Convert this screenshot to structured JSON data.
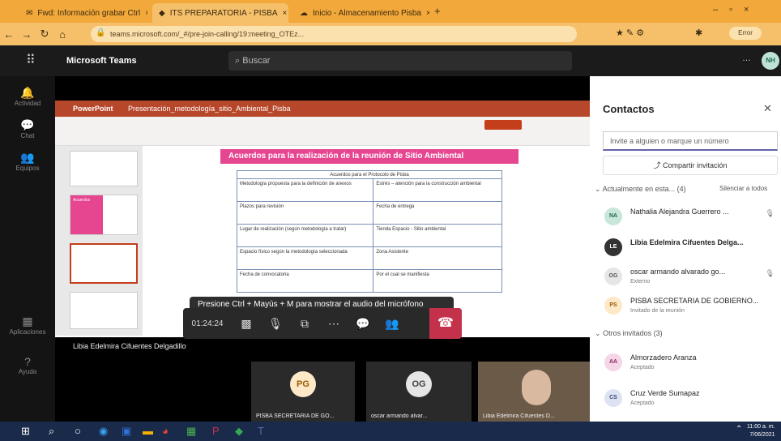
{
  "browser": {
    "tabs": [
      {
        "title": "Fwd: Información grabar Ctrl",
        "active": false
      },
      {
        "title": "ITS PREPARATORIA - PISBA",
        "active": true
      },
      {
        "title": "Inicio - Almacenamiento Pisba",
        "active": false
      }
    ],
    "url": "teams.microsoft.com/_#/pre-join-calling/19:meeting_OTEz..."
  },
  "teams": {
    "app_name": "Microsoft Teams",
    "search_placeholder": "Buscar",
    "user_initials": "NH"
  },
  "rail": {
    "items": [
      "Actividad",
      "Chat",
      "Equipos",
      "Aplicaciones",
      "Ayuda"
    ]
  },
  "ppt": {
    "app": "PowerPoint",
    "file": "Presentación_metodología_sitio_Ambiental_Pisba",
    "slide_title": "Acuerdos para la realización de la reunión de Sitio Ambiental",
    "table_header": "Acuerdos para el Protocolo de Pisba",
    "rows": [
      [
        "Metodología propuesta para la definición de anexos",
        "Estrés – atención para la construcción ambiental"
      ],
      [
        "Plazos para revisión",
        "Fecha de entrega"
      ],
      [
        "Lugar de realización (según metodología a tratar)",
        "Tienda Espacio - Sitio ambiental"
      ],
      [
        "Espacio físico según la metodología seleccionada",
        "Zona Asistente"
      ],
      [
        "Fecha de convocatoria",
        "Por el cual se manifiesta"
      ]
    ],
    "slide_thumb_text": "Acuerdos"
  },
  "meeting": {
    "toast": "Presione Ctrl + Mayús + M para mostrar el audio del micrófono",
    "timer": "01:24:24",
    "presenter": "Libia Edelmira Cifuentes Delgadillo",
    "tiles": [
      {
        "initials": "PG",
        "name": "PISBA SECRETARIA DE GO..."
      },
      {
        "initials": "OG",
        "name": "oscar armando alvar..."
      },
      {
        "initials": "",
        "name": "Libia Edelmira Cifuentes D..."
      }
    ]
  },
  "contacts": {
    "title": "Contactos",
    "invite_placeholder": "Invite a alguien o marque un número",
    "share_label": "Compartir invitación",
    "section_current": "Actualmente en esta... (4)",
    "mute_all": "Silenciar a todos",
    "section_others": "Otros invitados (3)",
    "in_meeting": [
      {
        "initials": "NA",
        "name": "Nathalia Alejandra Guerrero ...",
        "sub": "",
        "color": "#c8e6d9",
        "text_color": "#1d6b54"
      },
      {
        "initials": "LE",
        "name": "Libia Edelmira Cifuentes Delga...",
        "sub": "",
        "color": "#333333",
        "text_color": "#ffffff"
      },
      {
        "initials": "OG",
        "name": "oscar armando alvarado go...",
        "sub": "Externo",
        "color": "#e6e6e6",
        "text_color": "#555555"
      },
      {
        "initials": "PS",
        "name": "PISBA SECRETARIA DE GOBIERNO...",
        "sub": "Invitado de la reunión",
        "color": "#fde8c8",
        "text_color": "#9a5a00"
      }
    ],
    "others": [
      {
        "initials": "AA",
        "name": "Almorzadero Aranza",
        "sub": "Aceptado",
        "color": "#f4d6e6",
        "text_color": "#8a2c5e"
      },
      {
        "initials": "CS",
        "name": "Cruz Verde Sumapaz",
        "sub": "Aceptado",
        "color": "#dde3f2",
        "text_color": "#3a4a7a"
      }
    ]
  },
  "taskbar": {
    "time": "11:00 a. m.",
    "date": "7/06/2021"
  }
}
